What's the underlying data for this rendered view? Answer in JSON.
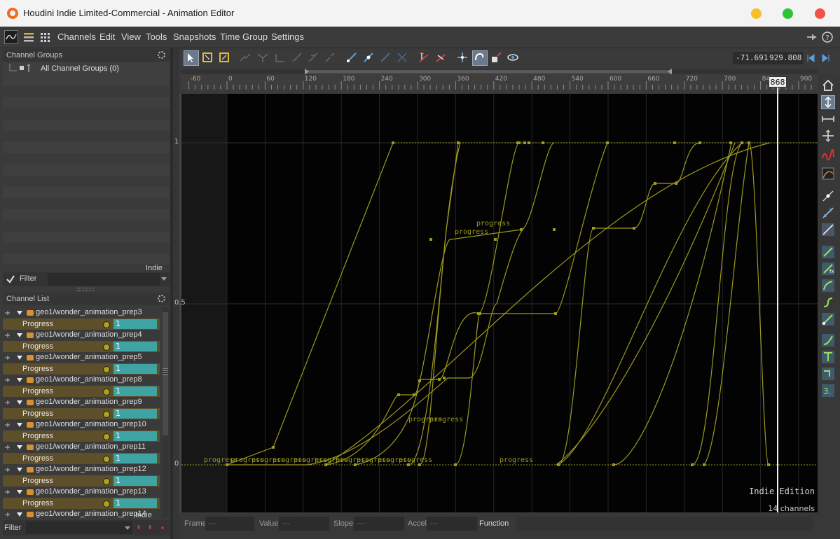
{
  "window": {
    "title": "Houdini Indie Limited-Commercial - Animation Editor",
    "buttons": {
      "minimize_color": "#f7c02a",
      "maximize_color": "#2fc338",
      "close_color": "#f2504a"
    }
  },
  "menubar": {
    "items": [
      "Channels",
      "Edit",
      "View",
      "Tools",
      "Snapshots",
      "Time Group",
      "Settings"
    ]
  },
  "channel_groups": {
    "header": "Channel Groups",
    "item": "All Channel Groups (0)",
    "watermark": "Indie",
    "filter_label": "Filter"
  },
  "channel_list": {
    "header": "Channel List",
    "progress_label": "Progress",
    "progress_value": "1",
    "nodes": [
      "geo1/wonder_animation_prep3",
      "geo1/wonder_animation_prep4",
      "geo1/wonder_animation_prep5",
      "geo1/wonder_animation_prep8",
      "geo1/wonder_animation_prep9",
      "geo1/wonder_animation_prep10",
      "geo1/wonder_animation_prep11",
      "geo1/wonder_animation_prep12",
      "geo1/wonder_animation_prep13",
      "geo1/wonder_animation_prep14"
    ],
    "watermark": "Indie",
    "filter_label": "Filter"
  },
  "editor": {
    "range_start": "-71.691",
    "range_end": "929.808",
    "current_frame": "868",
    "ruler_ticks": [
      "-60",
      "0",
      "60",
      "120",
      "180",
      "240",
      "300",
      "360",
      "420",
      "480",
      "540",
      "600",
      "660",
      "720",
      "780",
      "840",
      "900"
    ],
    "y_ticks": [
      "1",
      "0.5",
      "0"
    ],
    "curve_label": "progress",
    "edition": "Indie Edition",
    "channels_count": "14 channels",
    "colors": {
      "curve": "#9c9a1c",
      "background": "#030303"
    }
  },
  "bottom_bar": {
    "frame_label": "Frame",
    "frame_value": "---",
    "value_label": "Value",
    "value_value": "---",
    "slope_label": "Slope",
    "slope_value": "---",
    "accel_label": "Accel",
    "accel_value": "---",
    "function_label": "Function"
  }
}
